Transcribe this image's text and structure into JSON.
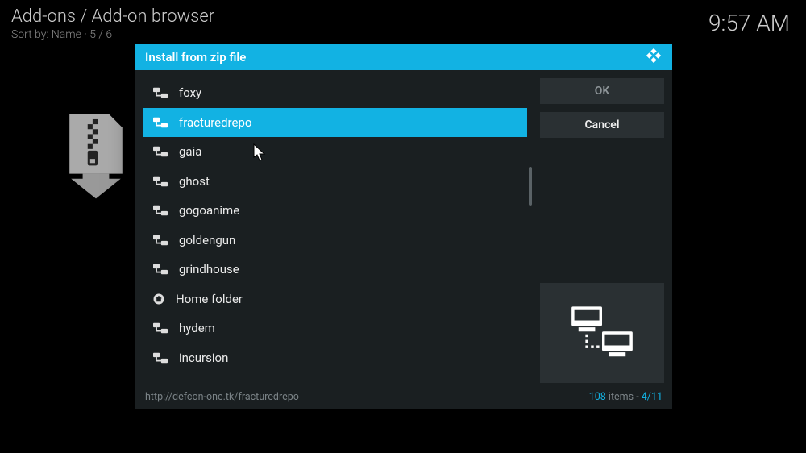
{
  "background": {
    "breadcrumb": "Add-ons / Add-on browser",
    "sort_label": "Sort by: Name",
    "sort_pos": "5 / 6",
    "time": "9:57 AM"
  },
  "dialog": {
    "title": "Install from zip file",
    "buttons": {
      "ok_label": "OK",
      "cancel_label": "Cancel"
    },
    "footer_path": "http://defcon-one.tk/fracturedrepo",
    "footer_count_num": "108",
    "footer_count_label": " items - ",
    "footer_pos": "4/11",
    "items": [
      {
        "label": "foxy",
        "type": "net",
        "selected": false
      },
      {
        "label": "fracturedrepo",
        "type": "net",
        "selected": true
      },
      {
        "label": "gaia",
        "type": "net",
        "selected": false
      },
      {
        "label": "ghost",
        "type": "net",
        "selected": false
      },
      {
        "label": "gogoanime",
        "type": "net",
        "selected": false
      },
      {
        "label": "goldengun",
        "type": "net",
        "selected": false
      },
      {
        "label": "grindhouse",
        "type": "net",
        "selected": false
      },
      {
        "label": "Home folder",
        "type": "home",
        "selected": false
      },
      {
        "label": "hydem",
        "type": "net",
        "selected": false
      },
      {
        "label": "incursion",
        "type": "net",
        "selected": false
      }
    ]
  }
}
